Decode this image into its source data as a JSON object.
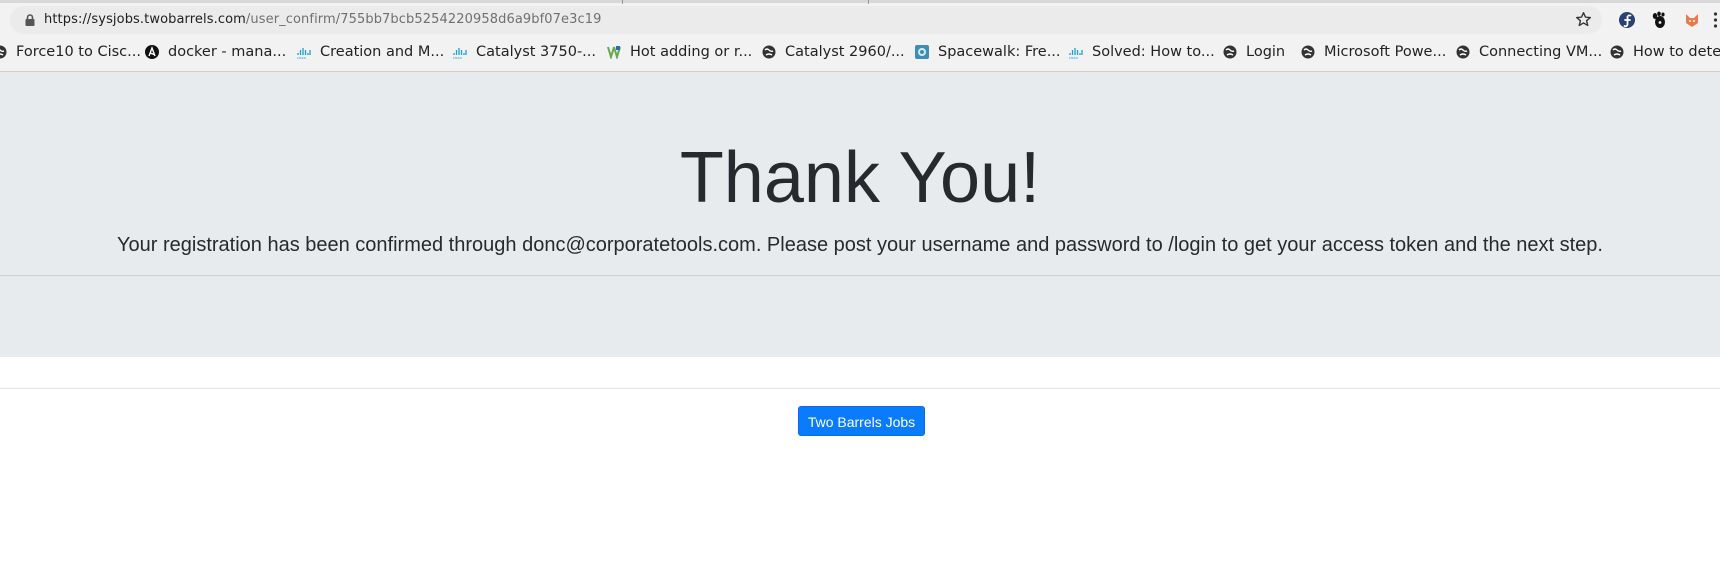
{
  "browser": {
    "url_host": "https://sysjobs.twobarrels.com",
    "url_path": "/user_confirm/755bb7bcb5254220958d6a9bf07e3c19",
    "bookmarks": [
      {
        "label": "Force10 to Cisc...",
        "icon": "globe-icon"
      },
      {
        "label": "docker - mana...",
        "icon": "ansible-icon"
      },
      {
        "label": "Creation and M...",
        "icon": "cisco-icon"
      },
      {
        "label": "Catalyst 3750-...",
        "icon": "cisco-icon"
      },
      {
        "label": "Hot adding or r...",
        "icon": "vmware-icon"
      },
      {
        "label": "Catalyst 2960/...",
        "icon": "globe-icon"
      },
      {
        "label": "Spacewalk: Fre...",
        "icon": "spacewalk-icon"
      },
      {
        "label": "Solved: How to...",
        "icon": "cisco-icon"
      },
      {
        "label": "Login",
        "icon": "globe-icon"
      },
      {
        "label": "Microsoft Powe...",
        "icon": "globe-icon"
      },
      {
        "label": "Connecting VM...",
        "icon": "globe-icon"
      },
      {
        "label": "How to detec",
        "icon": "globe-icon"
      }
    ],
    "extensions": [
      "fedora-icon",
      "gnome-icon",
      "fox-icon",
      "menu-icon"
    ]
  },
  "hero": {
    "title": "Thank You!",
    "message": "Your registration has been confirmed through donc@corporatetools.com. Please post your username and password to /login to get your access token and the next step."
  },
  "footer": {
    "button_label": "Two Barrels Jobs",
    "button_color": "#0a7bfd"
  }
}
